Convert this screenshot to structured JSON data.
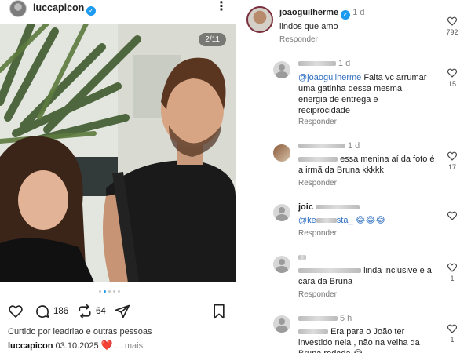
{
  "post": {
    "username": "luccapicon",
    "photo_counter": "2/11",
    "carousel_dots": 5,
    "carousel_active_index": 1,
    "comment_count": "186",
    "repost_count": "64",
    "liked_by": "Curtido por leadriao e outras pessoas",
    "caption_user": "luccapicon",
    "caption_date": "03.10.2025",
    "caption_emoji": "❤️",
    "caption_more": "... mais"
  },
  "comments": [
    {
      "user": "joaoguilherme",
      "verified": true,
      "time": "1 d",
      "text": "lindos que amo",
      "reply": "Responder",
      "likes": "792"
    },
    {
      "user": "",
      "time": "1 d",
      "mention": "@joaoguilherme",
      "text": " Falta vc arrumar uma gatinha dessa mesma energia de entrega e reciprocidade",
      "reply": "Responder",
      "likes": "15"
    },
    {
      "user": "",
      "time": "1 d",
      "mention": "",
      "text": "essa menina aí da foto é a irmã da Bruna kkkkk",
      "reply": "Responder",
      "likes": "17"
    },
    {
      "user": "joic",
      "time": "",
      "mention": "@ke",
      "text": "sta_ 😂😂😂",
      "reply": "Responder",
      "likes": ""
    },
    {
      "user": "",
      "time": "",
      "mention": "",
      "text": "linda inclusive e a cara da Bruna",
      "reply": "Responder",
      "likes": "1"
    },
    {
      "user": "",
      "time": "5 h",
      "mention": "",
      "text": "Era para o João ter investido nela , não na velha da Bruna rodada 😂",
      "reply": "",
      "likes": "1"
    }
  ],
  "colors": {
    "verified": "#1d9bf0",
    "mention": "#2f6fbf",
    "heart": "#e0245e"
  }
}
